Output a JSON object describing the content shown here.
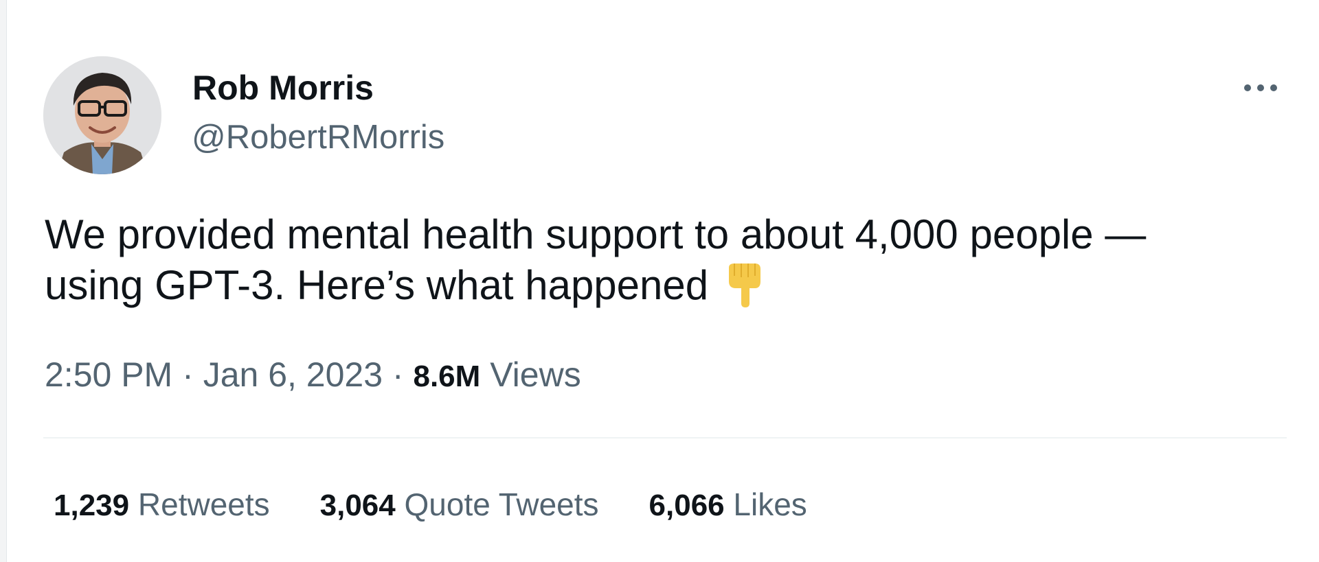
{
  "author": {
    "display_name": "Rob Morris",
    "handle": "@RobertRMorris"
  },
  "tweet": {
    "line1": "We provided mental health support to about 4,000 people —",
    "line2": "using GPT-3. Here’s what happened",
    "emoji": "backhand-index-pointing-down"
  },
  "meta": {
    "time": "2:50 PM",
    "separator": "·",
    "date": "Jan 6, 2023",
    "views_count": "8.6M",
    "views_label": "Views"
  },
  "stats": {
    "retweets_count": "1,239",
    "retweets_label": "Retweets",
    "quotes_count": "3,064",
    "quotes_label": "Quote Tweets",
    "likes_count": "6,066",
    "likes_label": "Likes"
  },
  "icons": {
    "more": "more-horizontal-icon"
  },
  "colors": {
    "primary_text": "#0f1419",
    "secondary_text": "#536471",
    "divider": "#eff3f4",
    "emoji_yellow": "#f5c94a"
  }
}
